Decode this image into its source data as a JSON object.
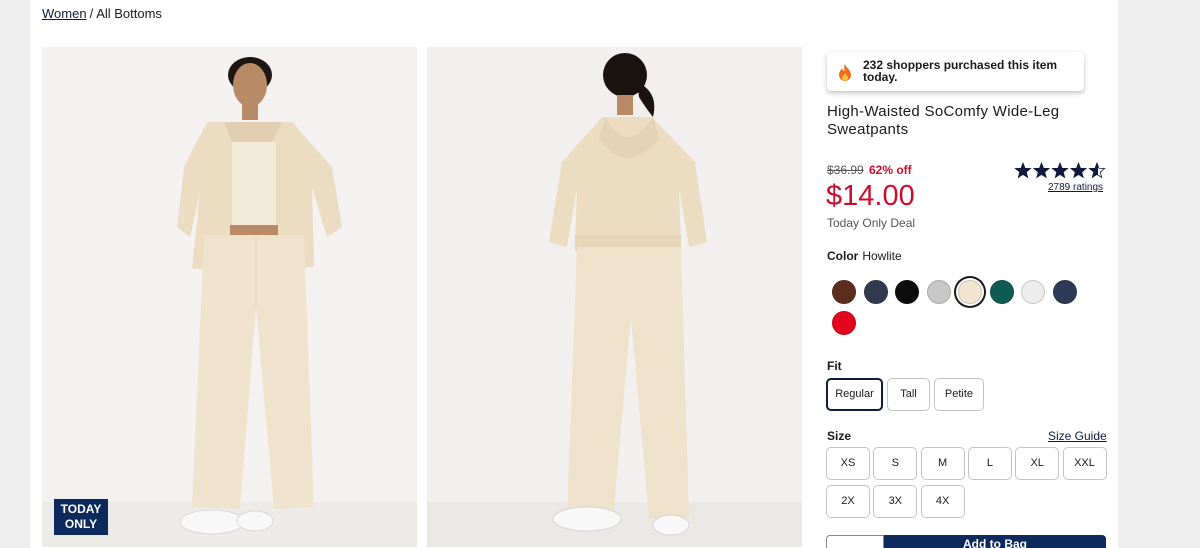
{
  "breadcrumb": {
    "root": "Women",
    "separator": "/",
    "current": "All Bottoms"
  },
  "badges": {
    "today_only_line1": "TODAY",
    "today_only_line2": "ONLY"
  },
  "social_proof": {
    "icon": "flame-icon",
    "text": "232 shoppers purchased this item today."
  },
  "product": {
    "title": "High-Waisted SoComfy Wide-Leg Sweatpants",
    "original_price": "$36.99",
    "discount": "62% off",
    "sale_price": "$14.00",
    "deal_label": "Today Only Deal",
    "rating": 4.5,
    "ratings_count": "2789 ratings"
  },
  "color": {
    "label": "Color",
    "selected_name": "Howlite",
    "swatches": [
      "#5b2e1e",
      "#323b4e",
      "#0c0c0c",
      "#c8c8c8",
      "#f2e6d3",
      "#0f5a52",
      "#ececec",
      "#2e3a55",
      "#e3051b"
    ],
    "selected_index": 4
  },
  "fit": {
    "label": "Fit",
    "options": [
      "Regular",
      "Tall",
      "Petite"
    ],
    "selected_index": 0
  },
  "size": {
    "label": "Size",
    "guide_label": "Size Guide",
    "options": [
      "XS",
      "S",
      "M",
      "L",
      "XL",
      "XXL",
      "2X",
      "3X",
      "4X"
    ]
  },
  "cart": {
    "add_label": "Add to Bag"
  },
  "colors": {
    "accent_navy": "#0e2a5c",
    "sale_red": "#c8102e"
  }
}
